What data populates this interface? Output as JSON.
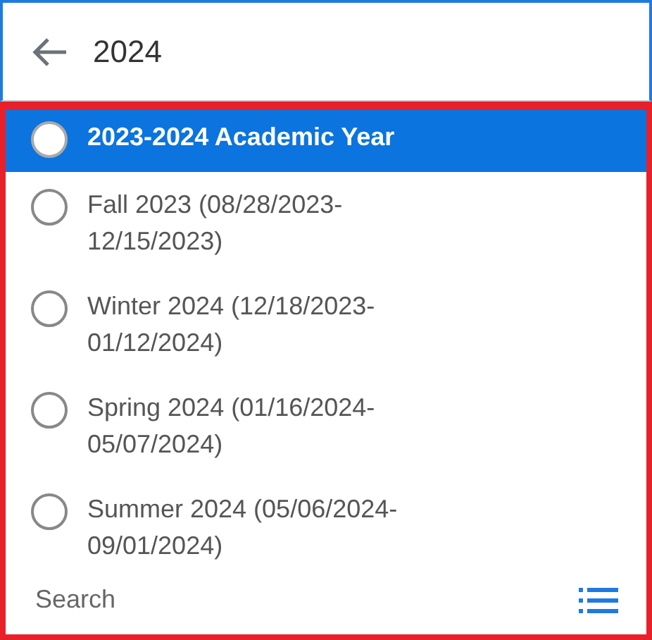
{
  "search_field": {
    "value": "2024"
  },
  "options": [
    {
      "label": "2023-2024 Academic Year",
      "selected": true
    },
    {
      "label": "Fall 2023 (08/28/2023-12/15/2023)",
      "selected": false
    },
    {
      "label": "Winter 2024 (12/18/2023-01/12/2024)",
      "selected": false
    },
    {
      "label": "Spring 2024 (01/16/2024-05/07/2024)",
      "selected": false
    },
    {
      "label": "Summer 2024 (05/06/2024-09/01/2024)",
      "selected": false
    }
  ],
  "footer": {
    "label": "Search"
  }
}
